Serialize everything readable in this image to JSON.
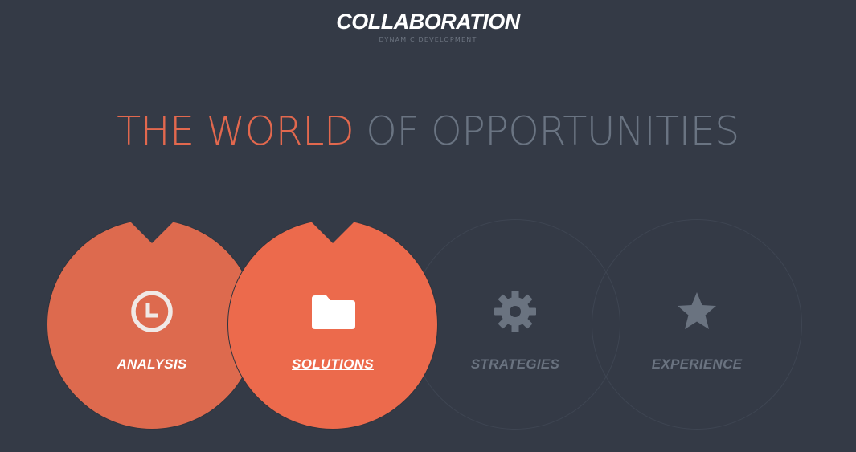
{
  "header": {
    "logo": "COLLABORATION",
    "tagline": "DYNAMIC DEVELOPMENT"
  },
  "hero": {
    "headline_accent": "THE WORLD",
    "headline_rest": "OF OPPORTUNITIES"
  },
  "colors": {
    "background": "#343a46",
    "accent": "#e2684e",
    "circle_analysis": "#dd6a4e",
    "circle_solutions": "#ec6a4c",
    "muted_text": "#6a7482"
  },
  "features": [
    {
      "label": "ANALYSIS",
      "icon": "clock-icon",
      "state": "filled"
    },
    {
      "label": "SOLUTIONS",
      "icon": "folder-icon",
      "state": "active"
    },
    {
      "label": "STRATEGIES",
      "icon": "gear-icon",
      "state": "outline"
    },
    {
      "label": "EXPERIENCE",
      "icon": "star-icon",
      "state": "outline"
    }
  ]
}
